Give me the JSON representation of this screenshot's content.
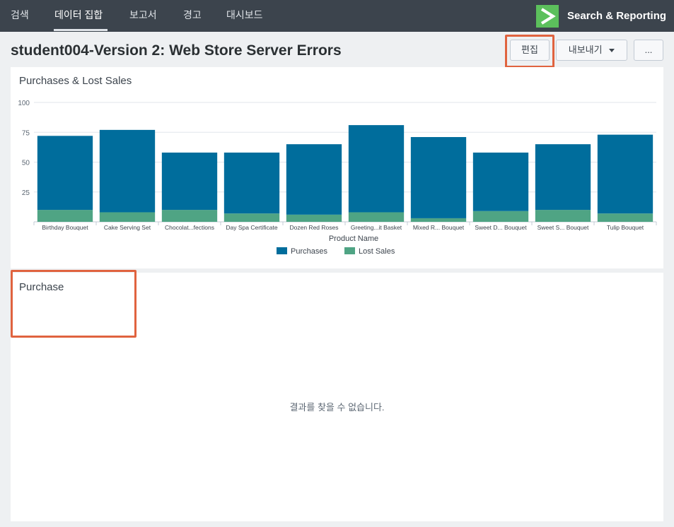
{
  "nav": {
    "items": [
      {
        "label": "검색",
        "active": false
      },
      {
        "label": "데이터 집합",
        "active": true
      },
      {
        "label": "보고서",
        "active": false
      },
      {
        "label": "경고",
        "active": false
      },
      {
        "label": "대시보드",
        "active": false
      }
    ],
    "app_title": "Search & Reporting",
    "app_logo_icon": "splunk-chevron-logo-icon"
  },
  "page": {
    "title": "student004-Version 2: Web Store Server Errors"
  },
  "toolbar": {
    "edit_label": "편집",
    "export_label": "내보내기",
    "more_label": "..."
  },
  "panels": {
    "chart_title": "Purchases & Lost Sales",
    "purchase_title": "Purchase",
    "no_results_text": "결과를 찾을 수 없습니다."
  },
  "colors": {
    "purchases": "#006d9c",
    "lost_sales": "#4fa484",
    "highlight": "#e0633f",
    "nav_bg": "#3c444d",
    "logo_green": "#5cc05c"
  },
  "chart_data": {
    "type": "bar",
    "stacked": true,
    "xlabel": "Product Name",
    "ylabel": "",
    "ylim": [
      0,
      100
    ],
    "yticks": [
      25,
      50,
      75,
      100
    ],
    "categories": [
      "Birthday Bouquet",
      "Cake Serving Set",
      "Chocolat...fections",
      "Day Spa Certificate",
      "Dozen Red Roses",
      "Greeting...it Basket",
      "Mixed R... Bouquet",
      "Sweet D... Bouquet",
      "Sweet S... Bouquet",
      "Tulip Bouquet"
    ],
    "series": [
      {
        "name": "Lost Sales",
        "values": [
          10,
          8,
          10,
          7,
          6,
          8,
          3,
          9,
          10,
          7
        ]
      },
      {
        "name": "Purchases",
        "values": [
          62,
          69,
          48,
          51,
          59,
          73,
          68,
          49,
          55,
          66
        ]
      }
    ],
    "legend": "bottom",
    "legend_order": [
      "Purchases",
      "Lost Sales"
    ],
    "grid": true
  }
}
